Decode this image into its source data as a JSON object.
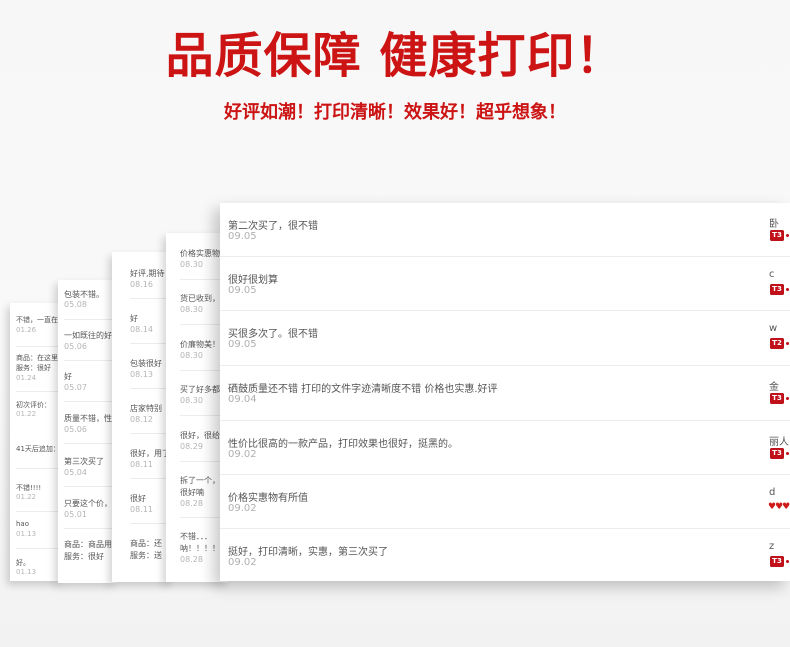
{
  "header": {
    "title": "品质保障 健康打印！",
    "subtitle": "好评如潮！打印清晰！效果好！超乎想象！"
  },
  "cards": [
    {
      "items": [
        {
          "text": "不错，一直在我",
          "date": "01.26"
        },
        {
          "text": "商品：在这里我",
          "date": ""
        },
        {
          "text": "服务：很好",
          "date": "01.24"
        },
        {
          "text": "初次评价：",
          "date": "01.22"
        },
        {
          "text": "41天后追加：",
          "date": ""
        },
        {
          "text": "不错!!!!",
          "date": "01.22"
        },
        {
          "text": "hao",
          "date": "01.13"
        },
        {
          "text": "好。",
          "date": "01.13"
        }
      ]
    },
    {
      "items": [
        {
          "text": "包装不错。",
          "date": "05.08"
        },
        {
          "text": "一如既往的好",
          "date": "05.06"
        },
        {
          "text": "好",
          "date": "05.07"
        },
        {
          "text": "质量不错，性价",
          "date": "05.06"
        },
        {
          "text": "第三次买了",
          "date": "05.04"
        },
        {
          "text": "只要这个价，真",
          "date": "05.01"
        },
        {
          "text": "商品：商品用着",
          "date": ""
        },
        {
          "text": "服务：很好",
          "date": ""
        }
      ]
    },
    {
      "items": [
        {
          "text": "好评,期待",
          "date": "08.16"
        },
        {
          "text": "好",
          "date": "08.14"
        },
        {
          "text": "包装很好",
          "date": "08.13"
        },
        {
          "text": "店家特别",
          "date": "08.12"
        },
        {
          "text": "很好，用了",
          "date": "08.11"
        },
        {
          "text": "很好",
          "date": "08.11"
        },
        {
          "text": "商品：还",
          "date": ""
        },
        {
          "text": "服务：送",
          "date": ""
        }
      ]
    },
    {
      "items": [
        {
          "text": "价格实惠物",
          "date": "08.30"
        },
        {
          "text": "货已收到，",
          "date": "08.30"
        },
        {
          "text": "价廉物美！",
          "date": "08.30"
        },
        {
          "text": "买了好多都",
          "date": "08.30"
        },
        {
          "text": "很好，很给",
          "date": "08.29"
        },
        {
          "text": "拆了一个，",
          "date": ""
        },
        {
          "text": "很好喃",
          "date": "08.28"
        },
        {
          "text": "不错．．．",
          "date": ""
        },
        {
          "text": "呐！！！！",
          "date": "08.28"
        }
      ]
    }
  ],
  "main": {
    "reviews": [
      {
        "text": "第二次买了，很不错",
        "date": "09.05",
        "user": "卧",
        "badge": "T3"
      },
      {
        "text": "很好很划算",
        "date": "09.05",
        "user": "c",
        "badge": "T3"
      },
      {
        "text": "买很多次了。很不错",
        "date": "09.05",
        "user": "w",
        "badge": "T2"
      },
      {
        "text": "硒鼓质量还不错 打印的文件字迹清晰度不错 价格也实惠.好评",
        "date": "09.04",
        "user": "金",
        "badge": "T3"
      },
      {
        "text": "性价比很高的一款产品，打印效果也很好，挺黑的。",
        "date": "09.02",
        "user": "丽人",
        "badge": "T3"
      },
      {
        "text": "价格实惠物有所值",
        "date": "09.02",
        "user": "d",
        "badge": ""
      },
      {
        "text": "挺好，打印清晰，实惠，第三次买了",
        "date": "09.02",
        "user": "z",
        "badge": "T3"
      }
    ]
  },
  "colors": {
    "accent": "#cc1414",
    "badge": "#c0101a"
  }
}
